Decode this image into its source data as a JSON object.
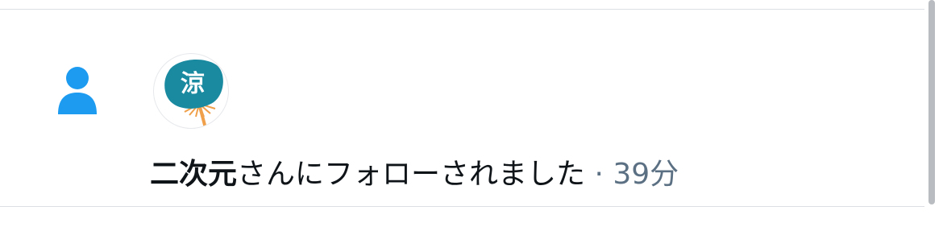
{
  "notification": {
    "icon": "person-icon",
    "avatar": {
      "icon": "uchiwa-fan-icon",
      "glyph": "涼"
    },
    "user_name": "二次元",
    "action_text": "さんにフォローされました",
    "separator": " · ",
    "time": "39分"
  },
  "colors": {
    "accent": "#1d9bf0",
    "text_primary": "#0f1419",
    "text_secondary": "#5b7083",
    "divider": "#dcdfe3",
    "fan_teal": "#1a8aa0",
    "fan_handle": "#f0a04a"
  }
}
